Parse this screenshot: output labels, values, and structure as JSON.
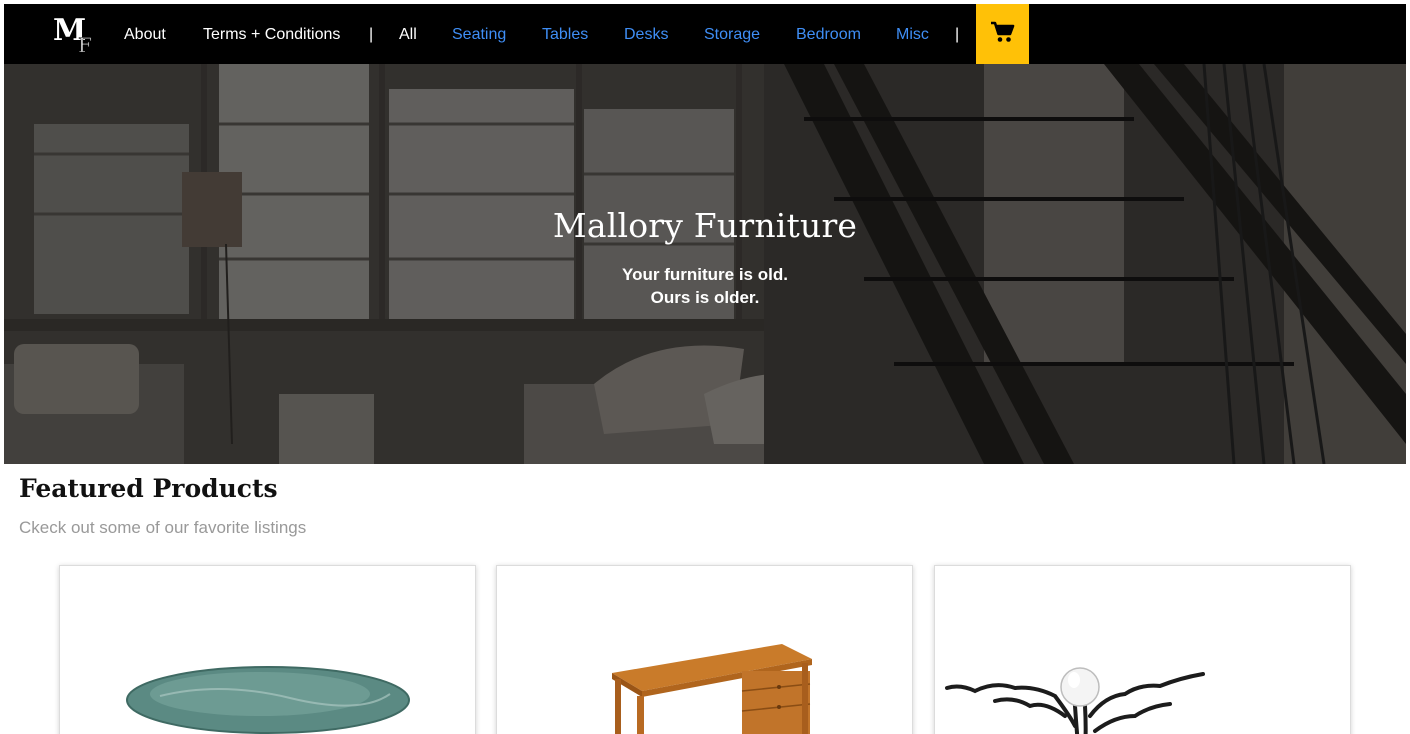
{
  "brand": {
    "logo_text": "MF",
    "name": "Mallory Furniture"
  },
  "nav": {
    "primary": [
      {
        "label": "About"
      },
      {
        "label": "Terms + Conditions"
      }
    ],
    "separator": "|",
    "all_label": "All",
    "categories": [
      {
        "label": "Seating"
      },
      {
        "label": "Tables"
      },
      {
        "label": "Desks"
      },
      {
        "label": "Storage"
      },
      {
        "label": "Bedroom"
      },
      {
        "label": "Misc"
      }
    ],
    "cart_icon": "shopping-cart-icon"
  },
  "hero": {
    "title": "Mallory Furniture",
    "tagline_1": "Your furniture is old.",
    "tagline_2": "Ours is older."
  },
  "featured": {
    "title": "Featured Products",
    "subtitle": "Ckeck out some of our favorite listings",
    "products": [
      {
        "image": "green-marble-table-top"
      },
      {
        "image": "wooden-writing-desk"
      },
      {
        "image": "wire-sculpture-lamp"
      }
    ]
  },
  "colors": {
    "nav_bg": "#000000",
    "nav_link_white": "#ffffff",
    "nav_link_blue": "#3f8ef5",
    "cart_bg": "#ffc107",
    "subtitle_gray": "#999999"
  }
}
